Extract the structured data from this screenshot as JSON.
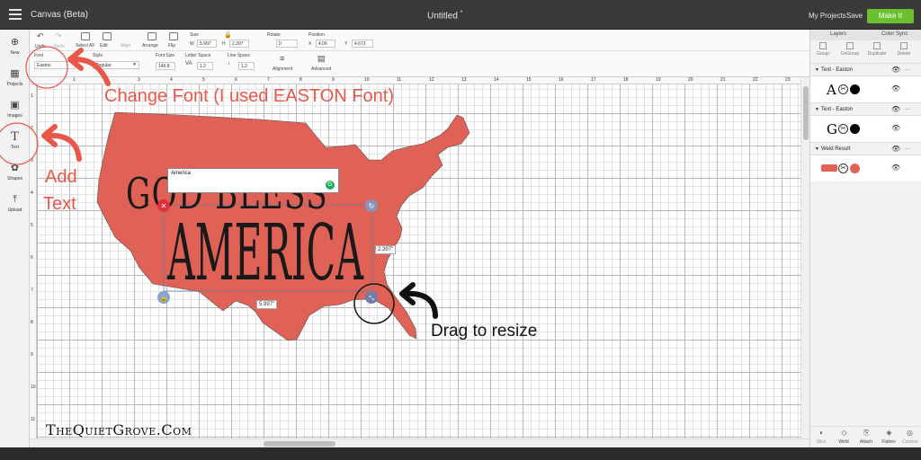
{
  "topbar": {
    "app_title": "Canvas (Beta)",
    "doc_title": "Untitled",
    "doc_modified_mark": "*",
    "my_projects": "My Projects",
    "save": "Save",
    "make_it": "Make It"
  },
  "leftbar": {
    "items": [
      {
        "label": "New",
        "icon": "plus-icon"
      },
      {
        "label": "Projects",
        "icon": "projects-icon"
      },
      {
        "label": "Images",
        "icon": "image-icon"
      },
      {
        "label": "Text",
        "icon": "text-icon"
      },
      {
        "label": "Shapes",
        "icon": "shapes-icon"
      },
      {
        "label": "Upload",
        "icon": "upload-icon"
      }
    ]
  },
  "toolbar": {
    "undo": "Undo",
    "redo": "Redo",
    "select_all": "Select All",
    "edit": "Edit",
    "align": "Align",
    "arrange": "Arrange",
    "flip": "Flip",
    "size_label": "Size",
    "w_label": "W",
    "w_value": "5.997",
    "h_label": "H",
    "h_value": "2.397",
    "rotate_label": "Rotate",
    "rotate_value": "0",
    "position_label": "Position",
    "x_label": "X",
    "x_value": "4.06",
    "y_label": "Y",
    "y_value": "4.673",
    "font_label": "Font",
    "font_value": "Easton",
    "style_label": "Style",
    "style_value": "Regular",
    "font_size_label": "Font Size",
    "font_size_value": "149.8",
    "letter_space_label": "Letter Space",
    "letter_space_value": "1.2",
    "line_space_label": "Line Space",
    "line_space_value": "1.2",
    "alignment": "Alignment",
    "advanced": "Advanced"
  },
  "ruler": {
    "top": [
      "1",
      "2",
      "3",
      "4",
      "5",
      "6",
      "7",
      "8",
      "9",
      "10",
      "11",
      "12",
      "13",
      "14",
      "15",
      "16",
      "17",
      "18",
      "19",
      "20",
      "21",
      "22",
      "23"
    ],
    "left": [
      "1",
      "2",
      "3",
      "4",
      "5",
      "6",
      "7",
      "8",
      "9",
      "10",
      "11"
    ]
  },
  "canvas": {
    "text_line1": "GOD BLESS",
    "text_line2": "AMERICA",
    "edit_box_value": "America",
    "width_badge": "5.997\"",
    "height_badge": "2.397\"",
    "map_color": "#e06256"
  },
  "annotations": {
    "change_font": "Change Font (I used EASTON Font)",
    "add_text_1": "Add",
    "add_text_2": "Text",
    "drag_resize": "Drag to resize",
    "watermark": "TheQuietGrove.Com",
    "annotation_color": "#e8574a"
  },
  "layers_panel": {
    "tabs": [
      "Layers",
      "Color Sync"
    ],
    "actions": [
      "Group",
      "UnGroup",
      "Duplicate",
      "Delete"
    ],
    "groups": [
      {
        "title": "Text - Easton",
        "glyph": "A"
      },
      {
        "title": "Text - Easton",
        "glyph": "G"
      },
      {
        "title": "Weld Result",
        "glyph": ""
      }
    ],
    "bottom_actions": [
      "Slice",
      "Weld",
      "Attach",
      "Flatten",
      "Contour"
    ]
  }
}
